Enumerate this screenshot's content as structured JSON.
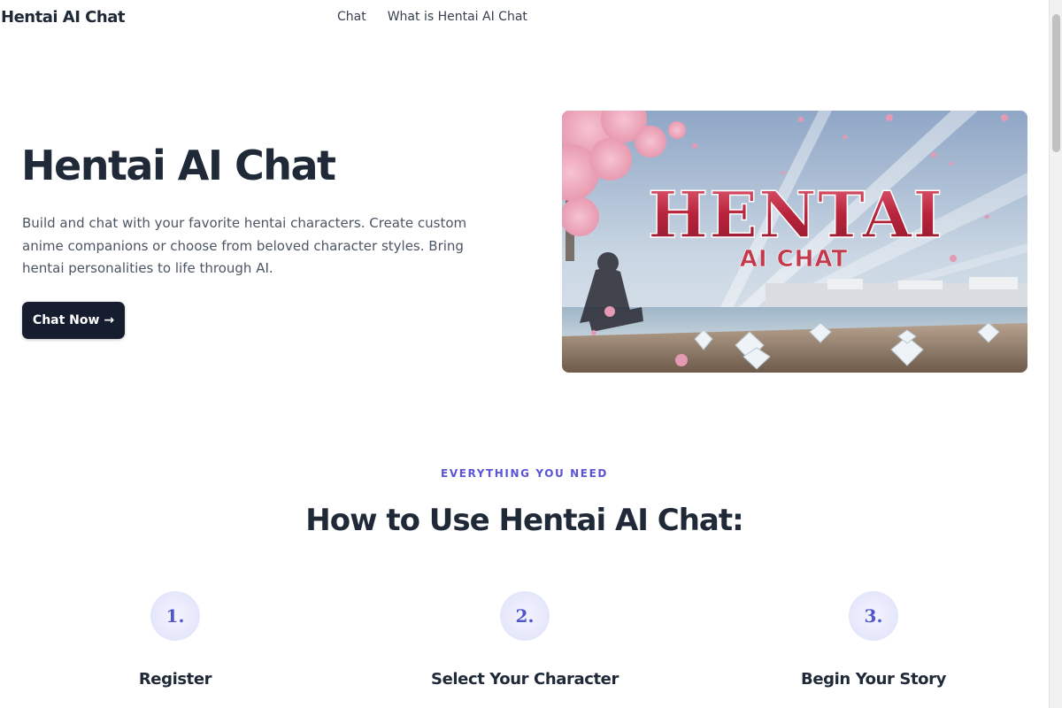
{
  "nav": {
    "brand": "Hentai AI Chat",
    "links": [
      "Chat",
      "What is Hentai AI Chat"
    ]
  },
  "hero": {
    "title": "Hentai AI Chat",
    "description": "Build and chat with your favorite hentai characters. Create custom anime companions or choose from beloved character styles. Bring hentai personalities to life through AI.",
    "cta_label": "Chat Now →",
    "image": {
      "title_text": "HENTAI",
      "subtitle_text": "AI CHAT"
    }
  },
  "features": {
    "eyebrow": "EVERYTHING YOU NEED",
    "title": "How to Use Hentai AI Chat:",
    "steps": [
      {
        "number": "1.",
        "title": "Register"
      },
      {
        "number": "2.",
        "title": "Select Your Character"
      },
      {
        "number": "3.",
        "title": "Begin Your Story"
      }
    ]
  },
  "colors": {
    "accent": "#5b54d6",
    "button_bg": "#161d2e",
    "heading": "#1f2937",
    "logo_red": "#c23a4e"
  }
}
